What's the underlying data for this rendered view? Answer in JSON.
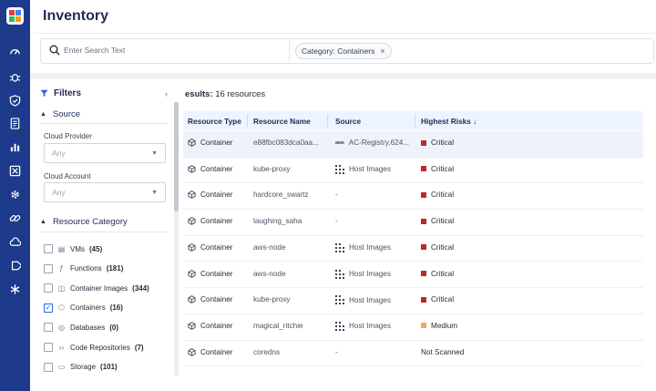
{
  "page": {
    "title": "Inventory"
  },
  "search": {
    "placeholder": "Enter Search Text",
    "chip_label": "Category: Containers",
    "chip_remove": "×"
  },
  "colors": {
    "rail": "#1e3a8a",
    "accent": "#2563eb",
    "critical": "#c0262d",
    "medium": "#f0a86a"
  },
  "rail_icons": [
    "dashboard-icon",
    "bug-icon",
    "shield-check-icon",
    "document-icon",
    "bar-chart-icon",
    "box-icon",
    "gear-icon",
    "link-icon",
    "cloud-icon",
    "tag-icon",
    "asterisk-icon"
  ],
  "filters": {
    "title": "Filters",
    "source_section": "Source",
    "cloud_provider_label": "Cloud Provider",
    "cloud_provider_value": "Any",
    "cloud_account_label": "Cloud Account",
    "cloud_account_value": "Any",
    "category_section": "Resource Category",
    "categories": [
      {
        "label": "VMs",
        "count": "(45)",
        "checked": false,
        "icon": "vm-icon"
      },
      {
        "label": "Functions",
        "count": "(181)",
        "checked": false,
        "icon": "function-icon"
      },
      {
        "label": "Container Images",
        "count": "(344)",
        "checked": false,
        "icon": "container-image-icon"
      },
      {
        "label": "Containers",
        "count": "(16)",
        "checked": true,
        "icon": "container-icon"
      },
      {
        "label": "Databases",
        "count": "(0)",
        "checked": false,
        "icon": "database-icon"
      },
      {
        "label": "Code Repositories",
        "count": "(7)",
        "checked": false,
        "icon": "code-icon"
      },
      {
        "label": "Storage",
        "count": "(101)",
        "checked": false,
        "icon": "storage-icon"
      }
    ]
  },
  "results": {
    "label": "esults:",
    "count": "16 resources",
    "columns": [
      "Resource Type",
      "Resource Name",
      "Source",
      "Highest Risks ↓"
    ],
    "rows": [
      {
        "type": "Container",
        "name": "e88fbc083dca0aa...",
        "source": "AC-Registry.624...",
        "source_icon": "aws",
        "risk": "Critical",
        "risk_color": "#c0262d"
      },
      {
        "type": "Container",
        "name": "kube-proxy",
        "source": "Host Images",
        "source_icon": "grid",
        "risk": "Critical",
        "risk_color": "#c0262d"
      },
      {
        "type": "Container",
        "name": "hardcore_swartz",
        "source": "-",
        "source_icon": "",
        "risk": "Critical",
        "risk_color": "#c0262d"
      },
      {
        "type": "Container",
        "name": "laughing_saha",
        "source": "-",
        "source_icon": "",
        "risk": "Critical",
        "risk_color": "#c0262d"
      },
      {
        "type": "Container",
        "name": "aws-node",
        "source": "Host Images",
        "source_icon": "grid",
        "risk": "Critical",
        "risk_color": "#c0262d"
      },
      {
        "type": "Container",
        "name": "aws-node",
        "source": "Host Images",
        "source_icon": "grid",
        "risk": "Critical",
        "risk_color": "#c0262d"
      },
      {
        "type": "Container",
        "name": "kube-proxy",
        "source": "Host Images",
        "source_icon": "grid",
        "risk": "Critical",
        "risk_color": "#c0262d"
      },
      {
        "type": "Container",
        "name": "magical_ritchie",
        "source": "Host Images",
        "source_icon": "grid",
        "risk": "Medium",
        "risk_color": "#f0a86a"
      },
      {
        "type": "Container",
        "name": "coredns",
        "source": "-",
        "source_icon": "",
        "risk": "Not Scanned",
        "risk_color": ""
      }
    ]
  },
  "aws_text": "aws"
}
